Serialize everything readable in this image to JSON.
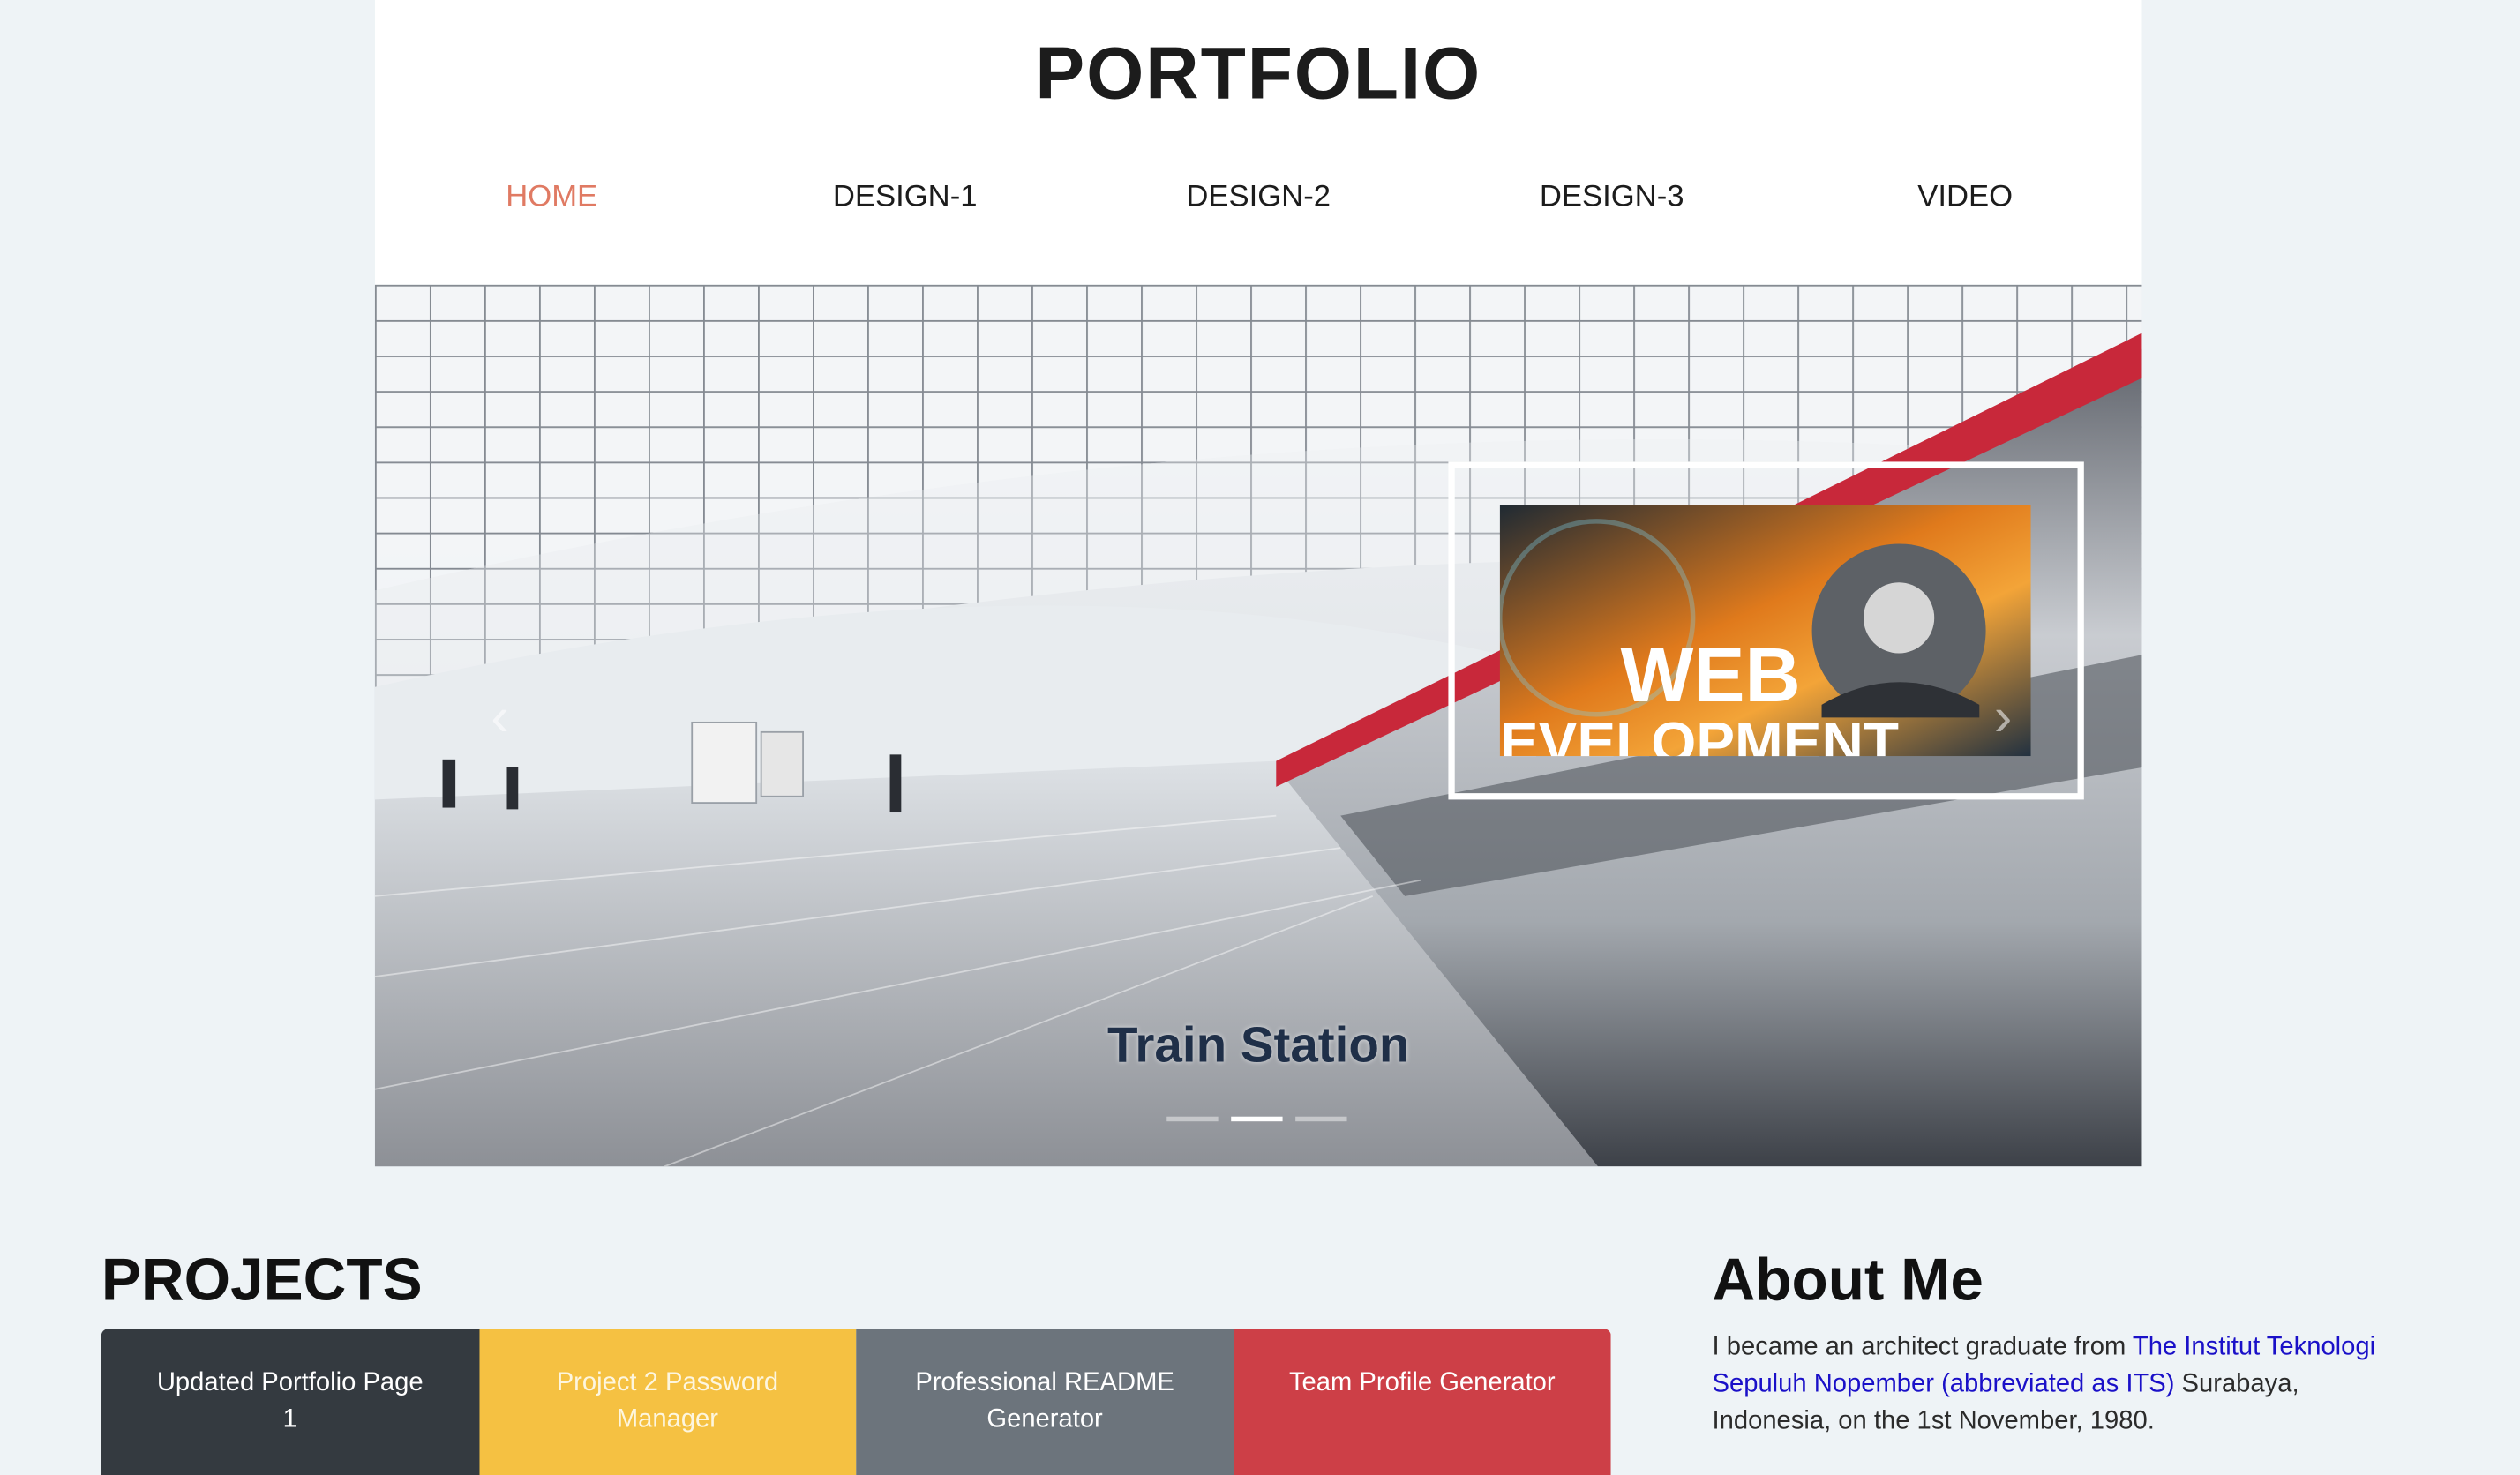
{
  "header": {
    "title": "PORTFOLIO"
  },
  "nav": {
    "items": [
      {
        "label": "HOME",
        "active": true
      },
      {
        "label": "DESIGN-1"
      },
      {
        "label": "DESIGN-2"
      },
      {
        "label": "DESIGN-3"
      },
      {
        "label": "VIDEO"
      }
    ]
  },
  "carousel": {
    "caption": "Train Station",
    "active_index": 1,
    "slide_count": 3,
    "inset_text": "WEB\nEVELOPMENT"
  },
  "projects": {
    "heading": "PROJECTS",
    "items": [
      {
        "label": "Updated Portfolio Page 1",
        "color": "#343a40"
      },
      {
        "label": "Project 2 Password Manager",
        "color": "#f5c142"
      },
      {
        "label": "Professional README Generator",
        "color": "#6c747c"
      },
      {
        "label": "Team Profile Generator",
        "color": "#cd3f47"
      }
    ]
  },
  "about": {
    "heading": "About Me",
    "text_before": "I became an architect graduate from ",
    "link_text": "The Institut Teknologi Sepuluh Nopember (abbreviated as ITS)",
    "text_after": " Surabaya, Indonesia, on the 1st November, 1980."
  }
}
